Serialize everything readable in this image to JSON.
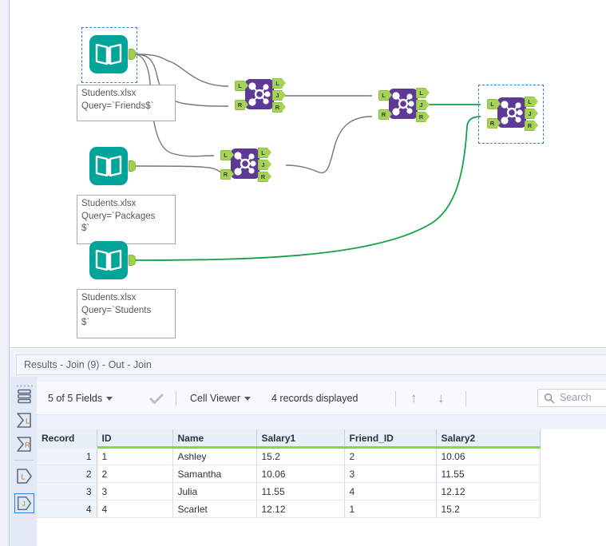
{
  "canvas": {
    "input_nodes": [
      {
        "id": "friends",
        "icon": "excel-book-icon",
        "selected": true,
        "annotation": "Students.xlsx\nQuery=`Friends$`"
      },
      {
        "id": "packages",
        "icon": "excel-book-icon",
        "selected": false,
        "annotation": "Students.xlsx\nQuery=`Packages\n$`"
      },
      {
        "id": "students",
        "icon": "excel-book-icon",
        "selected": false,
        "annotation": "Students.xlsx\nQuery=`Students\n$`"
      }
    ],
    "join_nodes": [
      {
        "id": "join-1",
        "icon": "join-tool-icon",
        "selected": false,
        "inputs": [
          "L",
          "R"
        ],
        "outputs": [
          "L",
          "J",
          "R"
        ]
      },
      {
        "id": "join-2",
        "icon": "join-tool-icon",
        "selected": false,
        "inputs": [
          "L",
          "R"
        ],
        "outputs": [
          "L",
          "J",
          "R"
        ]
      },
      {
        "id": "join-3",
        "icon": "join-tool-icon",
        "selected": false,
        "inputs": [
          "L",
          "R"
        ],
        "outputs": [
          "L",
          "J",
          "R"
        ]
      },
      {
        "id": "join-9",
        "icon": "join-tool-icon",
        "selected": true,
        "inputs": [
          "L",
          "R"
        ],
        "outputs": [
          "L",
          "J",
          "R"
        ]
      }
    ],
    "colors": {
      "input_node": "#00a499",
      "join_node": "#5c3a96",
      "port": "#a5d356",
      "wire_inactive": "#767676",
      "wire_active": "#17a04a",
      "selection": "#2a7fe0"
    }
  },
  "results": {
    "title": "Results - Join (9) - Out - Join",
    "toolbar": {
      "fields_label": "5 of 5 Fields",
      "check_icon": "checkmark-icon",
      "viewer_label": "Cell Viewer",
      "records_label": "4 records displayed",
      "up_icon": "arrow-up-icon",
      "down_icon": "arrow-down-icon",
      "grip_icon": "drag-grip-icon"
    },
    "search": {
      "placeholder": "Search",
      "icon": "search-icon"
    },
    "side_icons": [
      {
        "name": "table-view-icon",
        "label": "",
        "selected": false
      },
      {
        "name": "input-left-icon",
        "label": "L",
        "selected": false
      },
      {
        "name": "input-right-icon",
        "label": "R",
        "selected": false
      },
      {
        "name": "output-left-icon",
        "label": "L",
        "selected": false
      },
      {
        "name": "output-join-icon",
        "label": "J",
        "selected": true
      }
    ],
    "table": {
      "columns": [
        "Record",
        "ID",
        "Name",
        "Salary1",
        "Friend_ID",
        "Salary2"
      ],
      "rows": [
        [
          "1",
          "1",
          "Ashley",
          "15.2",
          "2",
          "10.06"
        ],
        [
          "2",
          "2",
          "Samantha",
          "10.06",
          "3",
          "11.55"
        ],
        [
          "3",
          "3",
          "Julia",
          "11.55",
          "4",
          "12.12"
        ],
        [
          "4",
          "4",
          "Scarlet",
          "12.12",
          "1",
          "15.2"
        ]
      ]
    }
  }
}
